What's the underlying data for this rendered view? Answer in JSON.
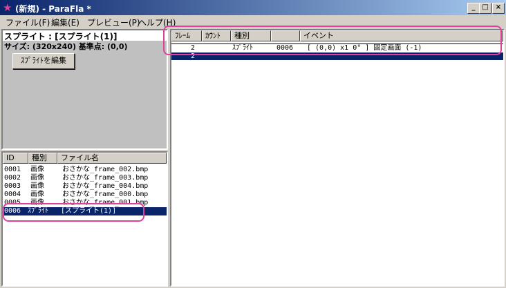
{
  "window": {
    "title": "(新規) - ParaFla *",
    "icon": "star-icon",
    "min": "_",
    "max": "□",
    "close": "×"
  },
  "menu": [
    "ファイル(F)",
    "編集(E)",
    "プレビュー(P)",
    "ヘルプ(H)"
  ],
  "sprite_panel": {
    "title": "スプライト : [スプライト(1)]",
    "size_line": "サイズ: (320x240)  基準点: (0,0)",
    "edit_button": "ｽﾌﾟﾗｲﾄを編集"
  },
  "file_list": {
    "columns": [
      "ID",
      "種別",
      "ファイル名"
    ],
    "rows": [
      {
        "id": "0001",
        "type": "画像",
        "name": "おさかな_frame_002.bmp"
      },
      {
        "id": "0002",
        "type": "画像",
        "name": "おさかな_frame_003.bmp"
      },
      {
        "id": "0003",
        "type": "画像",
        "name": "おさかな_frame_004.bmp"
      },
      {
        "id": "0004",
        "type": "画像",
        "name": "おさかな_frame_000.bmp"
      },
      {
        "id": "0005",
        "type": "画像",
        "name": "おさかな_frame_001.bmp"
      },
      {
        "id": "0006",
        "type": "ｽﾌﾟﾗｲﾄ",
        "name": "[スプライト(1)]"
      }
    ],
    "selected_index": 5
  },
  "timeline": {
    "columns": [
      "ﾌﾚｰﾑ",
      "ｶｳﾝﾄ",
      "種別",
      "",
      "イベント"
    ],
    "rows": [
      {
        "frame": "2",
        "count": "",
        "type": "ｽﾌﾟﾗｲﾄ",
        "id": "0006",
        "event": "[     (0,0)       x1    0° ] 固定画面 (-1)"
      },
      {
        "frame": "2",
        "count": "",
        "type": "",
        "id": "",
        "event": ""
      }
    ]
  },
  "colors": {
    "highlight": "#e0409a",
    "selection": "#0a246a"
  }
}
